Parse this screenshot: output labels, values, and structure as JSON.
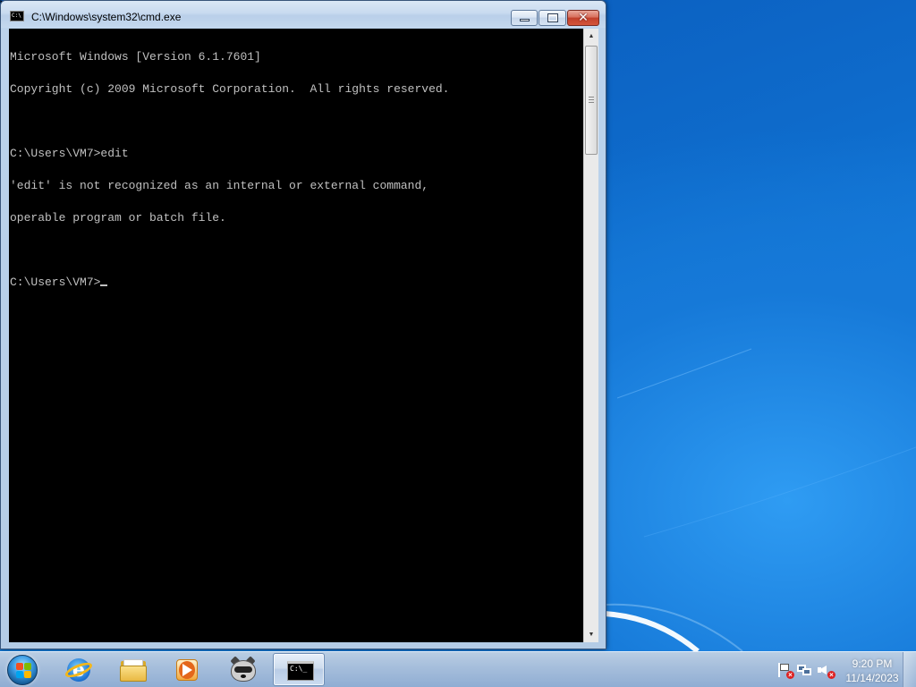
{
  "window": {
    "title": "C:\\Windows\\system32\\cmd.exe",
    "icon_label": "C:\\",
    "buttons": [
      "minimize",
      "maximize",
      "close"
    ],
    "close_glyph": "✕"
  },
  "console": {
    "lines": [
      "Microsoft Windows [Version 6.1.7601]",
      "Copyright (c) 2009 Microsoft Corporation.  All rights reserved.",
      "",
      "C:\\Users\\VM7>edit",
      "'edit' is not recognized as an internal or external command,",
      "operable program or batch file.",
      "",
      "C:\\Users\\VM7>"
    ],
    "foreground": "#c0c0c0",
    "background": "#000000"
  },
  "taskbar": {
    "pinned": [
      {
        "name": "internet-explorer",
        "icon": "ie-icon",
        "glyph": "e"
      },
      {
        "name": "windows-explorer",
        "icon": "folder-icon"
      },
      {
        "name": "windows-media-player",
        "icon": "media-player-icon"
      },
      {
        "name": "app-raccoon",
        "icon": "raccoon-icon"
      },
      {
        "name": "command-prompt",
        "icon": "cmd-icon",
        "glyph": "C:\\_",
        "active": true
      }
    ],
    "tray": {
      "icons": [
        "action-center-flag-icon",
        "network-icon",
        "volume-muted-icon"
      ],
      "time": "9:20 PM",
      "date": "11/14/2023"
    }
  },
  "colors": {
    "desktop_blue": "#0d63c5",
    "close_button_red": "#c1402b"
  }
}
